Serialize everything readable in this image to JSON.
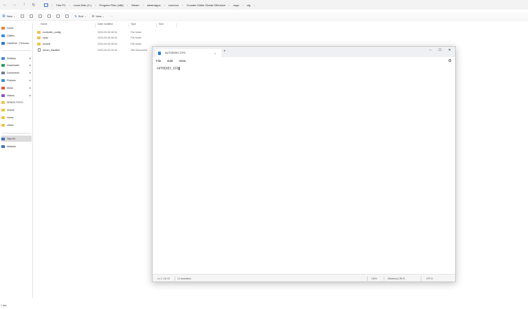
{
  "explorer": {
    "nav": {
      "back": "←",
      "forward": "→",
      "up": "↑",
      "refresh": "↻"
    },
    "breadcrumbs": [
      "This PC",
      "Local Disk (C:)",
      "Program Files (x86)",
      "Steam",
      "steamapps",
      "common",
      "Counter-Strike Global Offensive",
      "csgo",
      "cfg"
    ],
    "breadcrumb_sep": "›",
    "toolbar": {
      "new_label": "New",
      "sort_label": "Sort",
      "view_label": "View",
      "more_label": "···",
      "dropdown": "⌄"
    },
    "sidebar": {
      "top": [
        {
          "label": "Home",
          "icon": "home-icon"
        },
        {
          "label": "Gallery",
          "icon": "gallery-icon"
        },
        {
          "label": "OneDrive - Persona",
          "icon": "onedrive-icon"
        }
      ],
      "quick": [
        {
          "label": "Desktop",
          "icon": "desktop-icon",
          "pinned": true
        },
        {
          "label": "Downloads",
          "icon": "download-icon",
          "pinned": true
        },
        {
          "label": "Documents",
          "icon": "documents-icon",
          "pinned": true
        },
        {
          "label": "Pictures",
          "icon": "pictures-icon",
          "pinned": true
        },
        {
          "label": "Music",
          "icon": "music-icon",
          "pinned": true
        },
        {
          "label": "Videos",
          "icon": "videos-icon",
          "pinned": true
        },
        {
          "label": "SENOS FOTO",
          "icon": "folder-icon",
          "pinned": false
        },
        {
          "label": "zmone",
          "icon": "folder-icon",
          "pinned": false
        },
        {
          "label": "Home",
          "icon": "folder-icon",
          "pinned": false
        },
        {
          "label": "citram",
          "icon": "folder-icon",
          "pinned": false
        }
      ],
      "bottom": [
        {
          "label": "This PC",
          "icon": "pc-icon",
          "active": true
        },
        {
          "label": "Network",
          "icon": "network-icon",
          "active": false
        }
      ],
      "pin_glyph": "✱"
    },
    "columns": {
      "name": "Name",
      "date": "Date modified",
      "type": "Type",
      "size": "Size"
    },
    "files": [
      {
        "name": "controller_config",
        "date": "2023-09-28 06:34",
        "type": "File folder",
        "kind": "folder"
      },
      {
        "name": "csdp",
        "date": "2023-09-28 06:34",
        "type": "File folder",
        "kind": "folder"
      },
      {
        "name": "svconfi",
        "date": "2023-09-28 06:34",
        "type": "File folder",
        "kind": "folder"
      },
      {
        "name": "server_blacklist",
        "date": "2023-09-02 16:15",
        "type": "Text Document",
        "kind": "doc"
      }
    ],
    "status_count": "1 item"
  },
  "notepad": {
    "tab_title": "AUTOEXEC.CFG",
    "tab_close": "×",
    "new_tab": "+",
    "window": {
      "minimize": "–",
      "maximize": "☐",
      "close": "✕"
    },
    "menu": [
      "File",
      "Edit",
      "View"
    ],
    "settings": "⚙",
    "content": "AUTOEXEC.CFG",
    "status": {
      "position": "Ln 1, Col 13",
      "chars": "12 characters",
      "zoom": "100%",
      "line_ending": "Windows (CRLF)",
      "encoding": "UTF-8"
    }
  },
  "colors": {
    "accent": "#2f7fd1",
    "folder": "#f0c24b",
    "selected": "#dcdcdc"
  }
}
